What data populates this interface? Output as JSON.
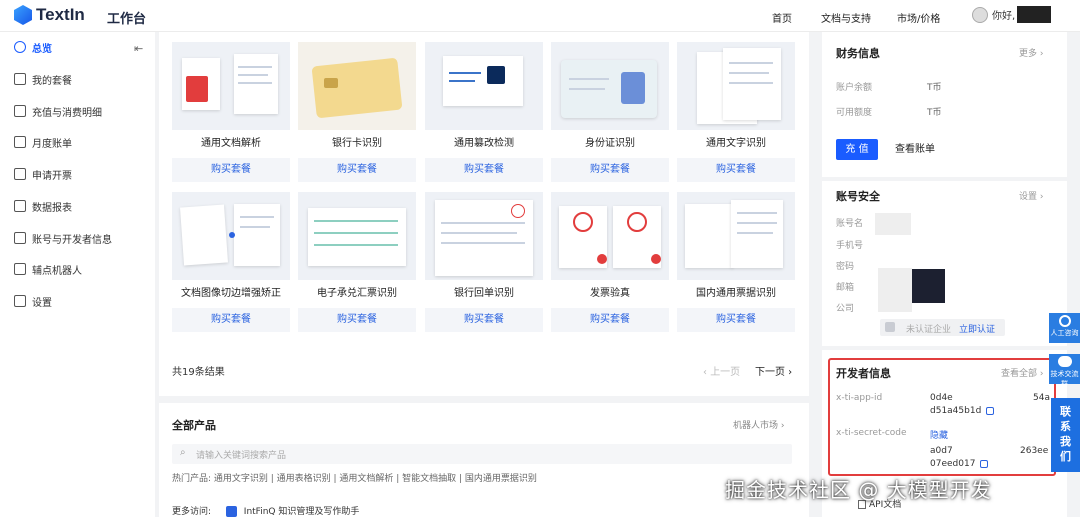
{
  "header": {
    "logo": "TextIn",
    "workspace": "工作台",
    "nav": [
      "首页",
      "文档与支持",
      "市场/价格"
    ],
    "greeting": "你好,"
  },
  "sidebar": {
    "items": [
      {
        "label": "总览",
        "icon": "dashboard-icon",
        "active": true
      },
      {
        "label": "我的套餐",
        "icon": "package-icon"
      },
      {
        "label": "充值与消费明细",
        "icon": "wallet-icon"
      },
      {
        "label": "月度账单",
        "icon": "bill-icon"
      },
      {
        "label": "申请开票",
        "icon": "invoice-icon"
      },
      {
        "label": "数据报表",
        "icon": "chart-icon"
      },
      {
        "label": "账号与开发者信息",
        "icon": "user-icon"
      },
      {
        "label": "辅点机器人",
        "icon": "robot-icon"
      },
      {
        "label": "设置",
        "icon": "settings-icon"
      }
    ]
  },
  "products": {
    "buy_label": "购买套餐",
    "cards": [
      {
        "title": "通用文档解析"
      },
      {
        "title": "银行卡识别"
      },
      {
        "title": "通用篡改检测"
      },
      {
        "title": "身份证识别"
      },
      {
        "title": "通用文字识别"
      },
      {
        "title": "文档图像切边增强矫正"
      },
      {
        "title": "电子承兑汇票识别"
      },
      {
        "title": "银行回单识别"
      },
      {
        "title": "发票验真"
      },
      {
        "title": "国内通用票据识别"
      }
    ],
    "count": "共19条结果",
    "prev": "上一页",
    "next": "下一页"
  },
  "all_products": {
    "title": "全部产品",
    "market_link": "机器人市场",
    "search_placeholder": "请输入关键词搜索产品",
    "hot": "热门产品: 通用文字识别 | 通用表格识别 | 通用文档解析 | 智能文档抽取 | 国内通用票据识别",
    "more_visit": "更多访问:",
    "intfinq": "IntFinQ 知识管理及写作助手"
  },
  "finance": {
    "title": "财务信息",
    "more": "更多",
    "balance_label": "账户余额",
    "balance_unit": "T币",
    "credit_label": "可用额度",
    "credit_unit": "T币",
    "recharge": "充 值",
    "view_bill": "查看账单"
  },
  "security": {
    "title": "账号安全",
    "settings": "设置",
    "fields": [
      "账号名",
      "手机号",
      "密码",
      "邮箱",
      "公司"
    ],
    "cert_status": "未认证企业",
    "cert_action": "立即认证"
  },
  "developer": {
    "title": "开发者信息",
    "view_all": "查看全部",
    "app_id_label": "x-ti-app-id",
    "app_id_line1": "0d4e",
    "app_id_line1_tail": "54a",
    "app_id_line2": "d51a45b1d",
    "secret_label": "x-ti-secret-code",
    "hide": "隐藏",
    "secret_line1": "a0d7",
    "secret_line1_tail": "263ee",
    "secret_line2": "07eed017",
    "api_doc": "API文档"
  },
  "float": {
    "service": "人工咨询",
    "group": "技术交流群",
    "contact": "联系我们"
  },
  "watermark": "掘金技术社区 @ 大模型开发",
  "colors": {
    "accent": "#1a5cff",
    "highlight": "#e23d3d"
  }
}
